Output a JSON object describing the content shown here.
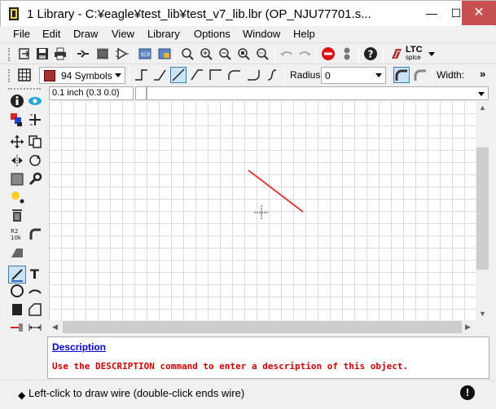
{
  "window": {
    "title": "1 Library - C:¥eagle¥test_lib¥test_v7_lib.lbr (OP_NJU77701.s...",
    "minimize": "—",
    "maximize": "☐",
    "close": "✕"
  },
  "menu": [
    "File",
    "Edit",
    "Draw",
    "View",
    "Library",
    "Options",
    "Window",
    "Help"
  ],
  "toolbar_main": {
    "icons": [
      "open-icon",
      "save-icon",
      "print-icon",
      "cam-icon",
      "board-icon",
      "schematic-icon",
      "script-icon",
      "ulp-icon",
      "zoom-fit-icon",
      "zoom-in-icon",
      "zoom-out-icon",
      "zoom-redraw-icon",
      "zoom-select-icon",
      "undo-icon",
      "redo-icon",
      "stop-icon",
      "go-icon",
      "help-icon",
      "ltspice-icon"
    ],
    "ltspice_label": "LTC",
    "ltspice_sub": "spice"
  },
  "toolbar_params": {
    "layer_value": "94 Symbols",
    "layer_color": "#a33333",
    "radius_label": "Radius:",
    "radius_value": "0",
    "width_label": "Width:",
    "overflow": "»"
  },
  "coord_field": "0.1 inch (0.3 0.0)",
  "description": {
    "title": "Description",
    "text": "Use the DESCRIPTION command to enter a description of this object."
  },
  "status": {
    "text": "Left-click to draw wire (double-click ends wire)",
    "diamond": "◆",
    "stop_icon": "!"
  },
  "accent": "#e03c3c"
}
